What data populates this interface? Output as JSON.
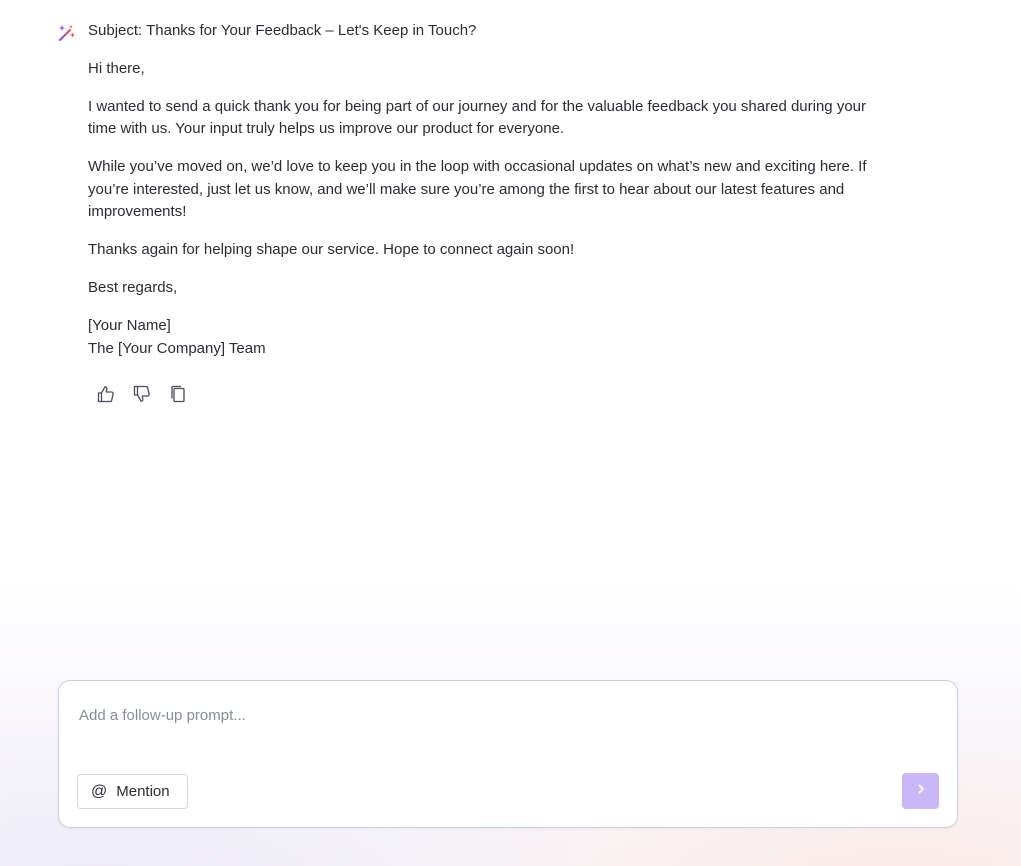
{
  "message": {
    "subject": "Subject: Thanks for Your Feedback – Let's Keep in Touch?",
    "greeting": "Hi there,",
    "paragraph1": "I wanted to send a quick thank you for being part of our journey and for the valuable feedback you shared during your time with us. Your input truly helps us improve our product for everyone.",
    "paragraph2": "While you’ve moved on, we’d love to keep you in the loop with occasional updates on what’s new and exciting here. If you’re interested, just let us know, and we’ll make sure you’re among the first to hear about our latest features and improvements!",
    "paragraph3": "Thanks again for helping shape our service. Hope to connect again soon!",
    "closing": "Best regards,",
    "signature_name": "[Your Name]",
    "signature_team": "The [Your Company] Team"
  },
  "actions": {
    "like_icon": "thumbs-up-icon",
    "dislike_icon": "thumbs-down-icon",
    "copy_icon": "copy-icon"
  },
  "composer": {
    "placeholder": "Add a follow-up prompt...",
    "value": "",
    "mention_symbol": "@",
    "mention_label": "Mention",
    "send_icon": "chevron-right-icon"
  },
  "colors": {
    "send_button": "#c8b8f8",
    "ai_icon_gradient": [
      "#f0523a",
      "#7c4dff"
    ]
  }
}
